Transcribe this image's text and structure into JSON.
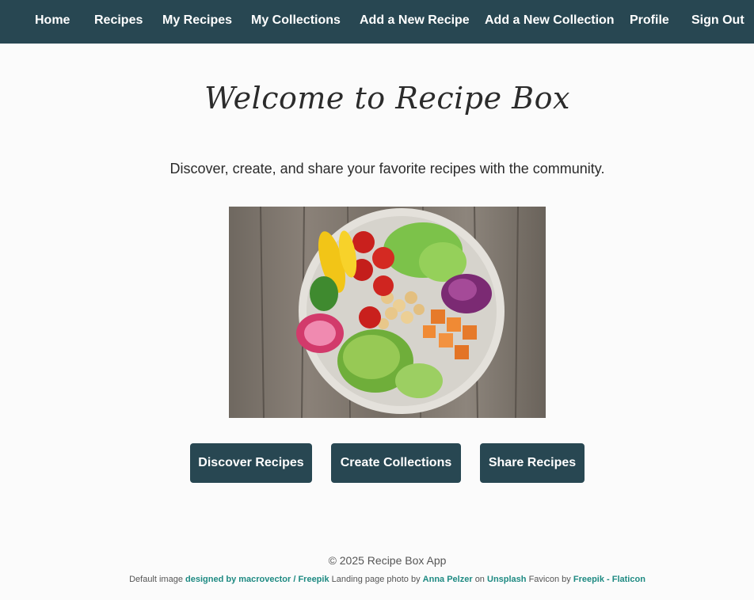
{
  "nav": {
    "home": "Home",
    "recipes": "Recipes",
    "my_recipes": "My Recipes",
    "my_collections": "My Collections",
    "add_recipe": "Add a New Recipe",
    "add_collection": "Add a New Collection",
    "profile": "Profile",
    "sign_out": "Sign Out"
  },
  "main": {
    "title": "Welcome to Recipe Box",
    "tagline": "Discover, create, and share your favorite recipes with the community.",
    "hero_image": "salad-bowl-photo",
    "buttons": {
      "discover": "Discover Recipes",
      "collections": "Create Collections",
      "share": "Share Recipes"
    }
  },
  "footer": {
    "copyright": "© 2025 Recipe Box App",
    "credits": {
      "default_image_prefix": "Default image",
      "default_image_link": "designed by macrovector / Freepik",
      "landing_prefix": "Landing page photo by",
      "photographer_link": "Anna Pelzer",
      "on_text": "on",
      "unsplash_link": "Unsplash",
      "favicon_prefix": "Favicon by",
      "favicon_link": "Freepik - Flaticon"
    }
  },
  "colors": {
    "navbar": "#284752",
    "button": "#284752",
    "link": "#1e8a82",
    "background": "#fbfbfb"
  }
}
